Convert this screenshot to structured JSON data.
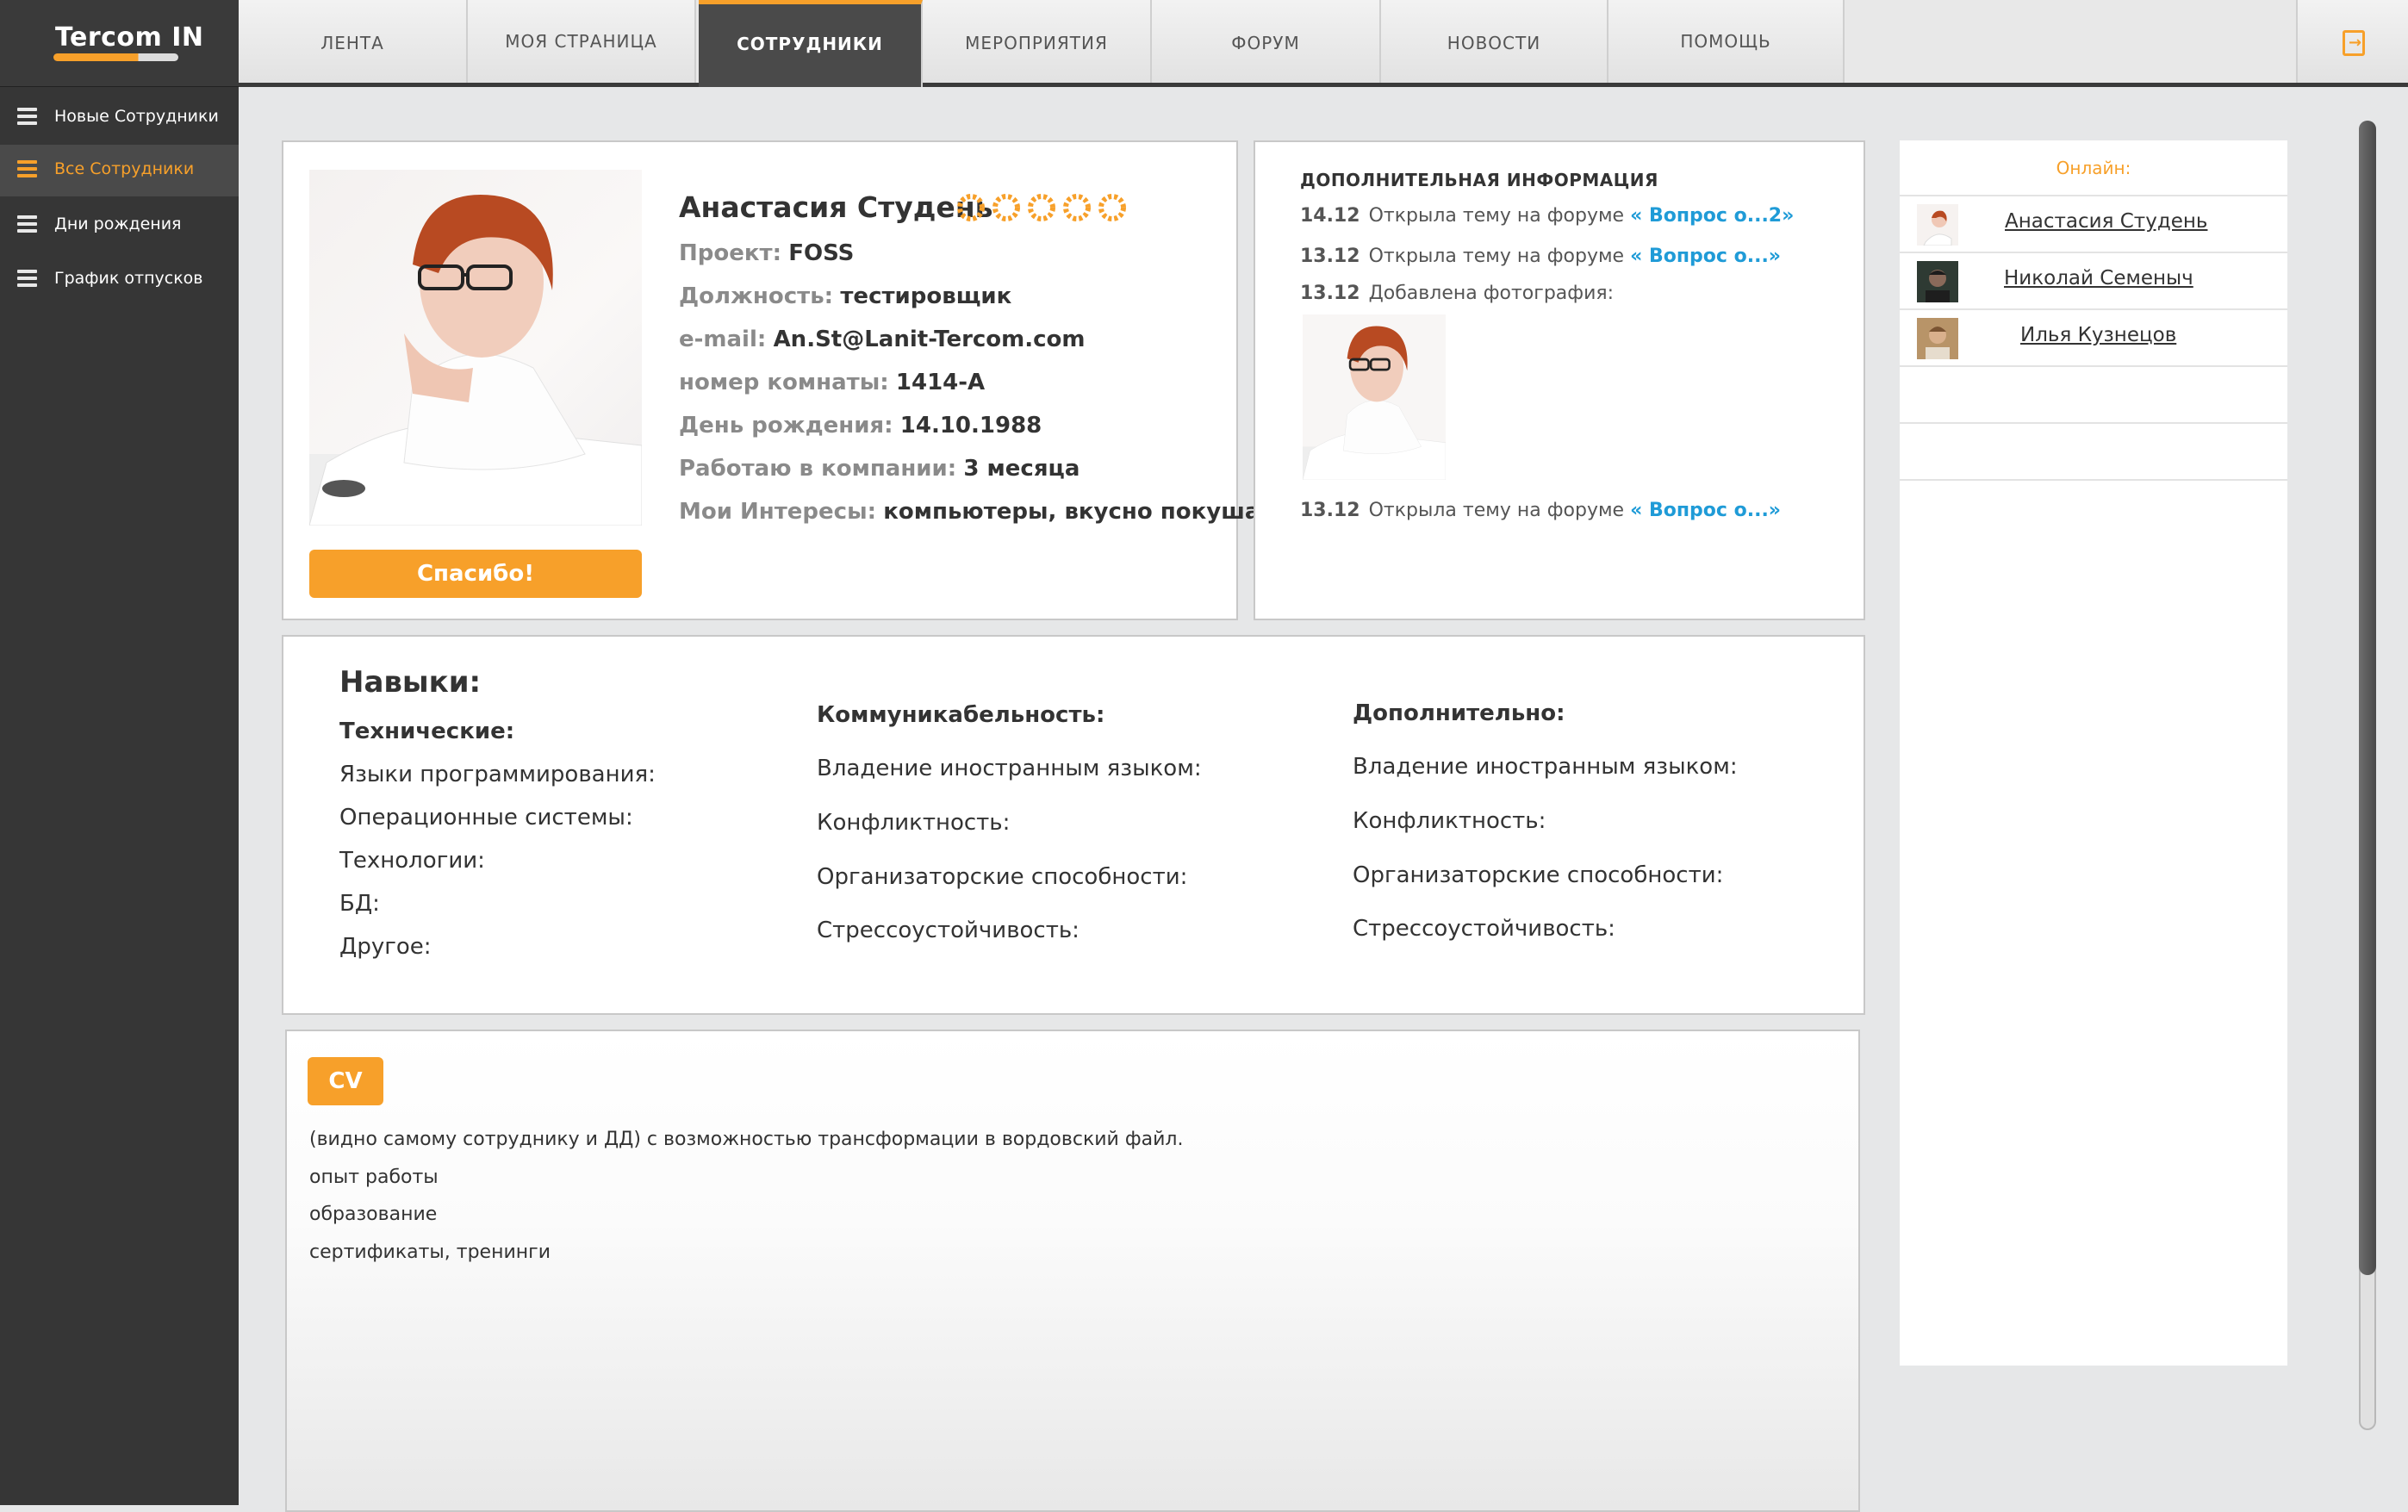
{
  "logo": {
    "text": "Tercom IN"
  },
  "sidebar": {
    "items": [
      {
        "label": "Новые Сотрудники",
        "active": false
      },
      {
        "label": "Все Сотрудники",
        "active": true
      },
      {
        "label": "Дни рождения",
        "active": false
      },
      {
        "label": "График отпусков",
        "active": false
      }
    ]
  },
  "nav": {
    "tabs": [
      {
        "label": "ЛЕНТА"
      },
      {
        "label": "МОЯ СТРАНИЦА"
      },
      {
        "label": "СОТРУДНИКИ",
        "active": true
      },
      {
        "label": "МЕРОПРИЯТИЯ"
      },
      {
        "label": "ФОРУМ"
      },
      {
        "label": "НОВОСТИ"
      },
      {
        "label": "ПОМОЩЬ"
      }
    ],
    "exit_icon": "logout-icon"
  },
  "profile": {
    "name": "Анастасия  Студень",
    "rating": 5,
    "fields": [
      {
        "label": "Проект:",
        "value": "FOSS"
      },
      {
        "label": "Должность:",
        "value": "тестировщик"
      },
      {
        "label": "e-mail:",
        "value": "An.St@Lanit-Tercom.com"
      },
      {
        "label": "номер комнаты:",
        "value": "1414-А"
      },
      {
        "label": "День рождения:",
        "value": "14.10.1988"
      },
      {
        "label": "Работаю в компании:",
        "value": "3 месяца"
      },
      {
        "label": "Мои Интересы:",
        "value": "компьютеры, вкусно покушать"
      }
    ],
    "thanks_button": "Спасибо!"
  },
  "additional": {
    "title": "ДОПОЛНИТЕЛЬНАЯ ИНФОРМАЦИЯ",
    "activity": [
      {
        "date": "14.12",
        "text": "Открыла тему на форуме",
        "link": "« Вопрос о...2»"
      },
      {
        "date": "13.12",
        "text": "Открыла тему на форуме",
        "link": "« Вопрос о...»"
      },
      {
        "date": "13.12",
        "text": "Добавлена фотография:",
        "link": ""
      },
      {
        "date": "13.12",
        "text": "Открыла тему на форуме",
        "link": "« Вопрос о...»"
      }
    ]
  },
  "online": {
    "title": "Онлайн:",
    "users": [
      {
        "name": "Анастасия  Студень"
      },
      {
        "name": "Николай  Семеныч"
      },
      {
        "name": "Илья  Кузнецов"
      }
    ]
  },
  "skills": {
    "title": "Навыки:",
    "columns": [
      {
        "heading": "Технические:",
        "items": [
          "Языки программирования:",
          "Операционные системы:",
          "Технологии:",
          "БД:",
          "Другое:"
        ]
      },
      {
        "heading": "Коммуникабельность:",
        "items": [
          "Владение иностранным языком:",
          "Конфликтность:",
          "Организаторские способности:",
          "Стрессоустойчивость:"
        ]
      },
      {
        "heading": "Дополнительно:",
        "items": [
          "Владение иностранным языком:",
          "Конфликтность:",
          "Организаторские способности:",
          "Стрессоустойчивость:"
        ]
      }
    ]
  },
  "cv": {
    "button": "CV",
    "lines": [
      "(видно самому сотруднику и ДД) с возможностью трансформации в вордовский файл.",
      "опыт работы",
      "образование",
      "сертификаты, тренинги"
    ]
  },
  "colors": {
    "accent": "#f7a02a",
    "link": "#1f9bd7",
    "sidebar": "#363636"
  }
}
